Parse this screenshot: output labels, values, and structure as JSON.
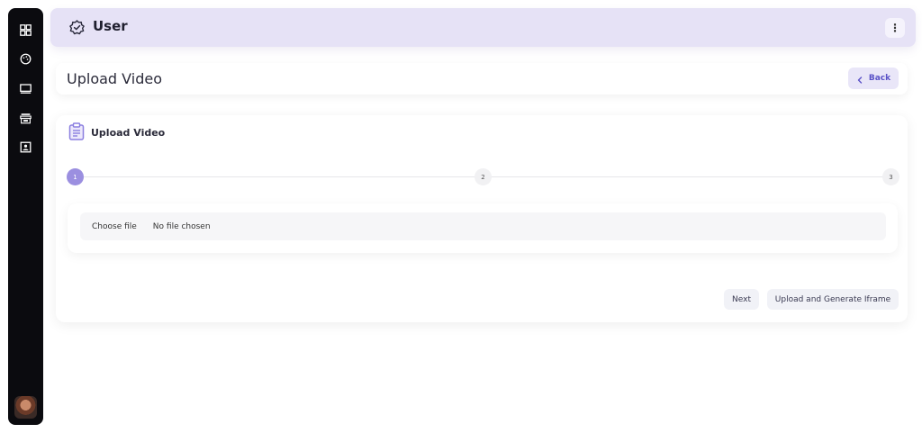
{
  "header": {
    "title": "User"
  },
  "page": {
    "title": "Upload Video",
    "back_label": "Back"
  },
  "card": {
    "title": "Upload Video"
  },
  "stepper": {
    "steps": [
      "1",
      "2",
      "3"
    ],
    "active_step": 1
  },
  "file_input": {
    "button_label": "Choose file",
    "status": "No file chosen"
  },
  "actions": {
    "next_label": "Next",
    "upload_label": "Upload and Generate Iframe"
  },
  "colors": {
    "accent": "#9b8fe0",
    "header_bg": "#e6e2f6",
    "sidebar_bg": "#0b0b0f"
  }
}
